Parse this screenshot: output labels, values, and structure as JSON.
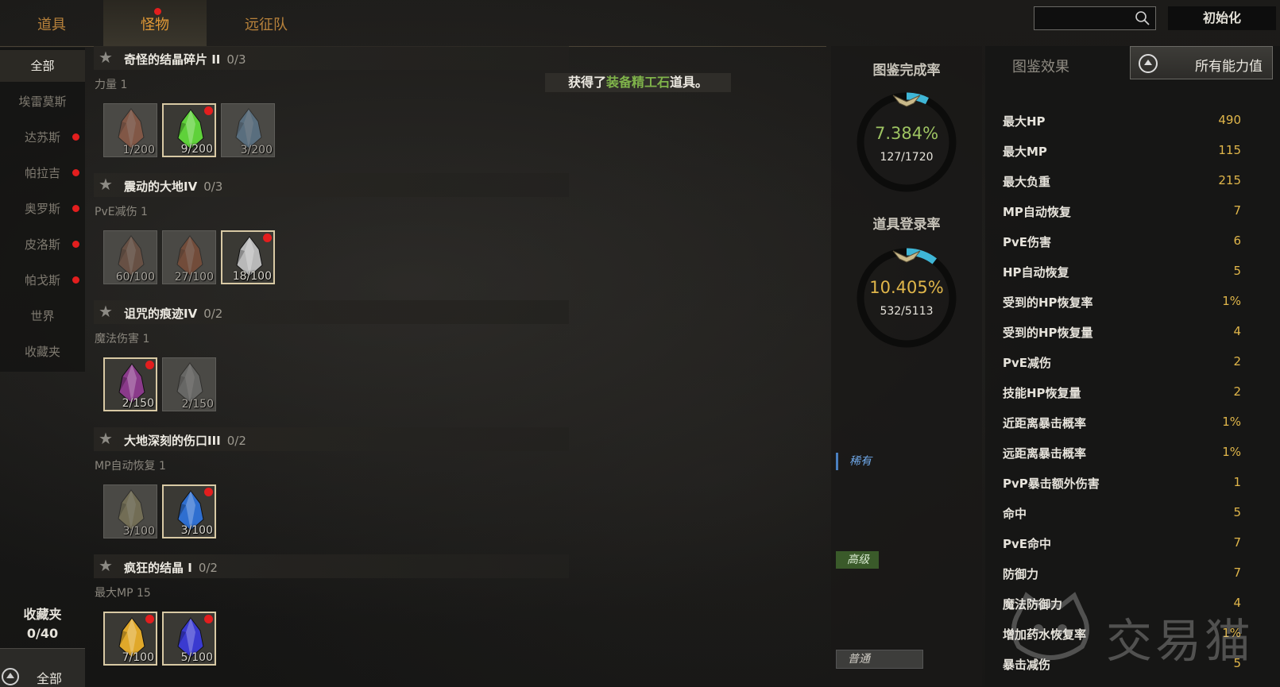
{
  "tabs": [
    {
      "label": "道具",
      "active": false,
      "badge": false
    },
    {
      "label": "怪物",
      "active": true,
      "badge": true
    },
    {
      "label": "远征队",
      "active": false,
      "badge": false
    }
  ],
  "search": {
    "value": "",
    "placeholder": ""
  },
  "init_button": "初始化",
  "sidebar": {
    "items": [
      {
        "label": "全部",
        "active": true,
        "badge": false
      },
      {
        "label": "埃雷莫斯",
        "active": false,
        "badge": false
      },
      {
        "label": "达苏斯",
        "active": false,
        "badge": true
      },
      {
        "label": "帕拉吉",
        "active": false,
        "badge": true
      },
      {
        "label": "奥罗斯",
        "active": false,
        "badge": true
      },
      {
        "label": "皮洛斯",
        "active": false,
        "badge": true
      },
      {
        "label": "帕戈斯",
        "active": false,
        "badge": true
      },
      {
        "label": "世界",
        "active": false,
        "badge": false
      },
      {
        "label": "收藏夹",
        "active": false,
        "badge": false
      }
    ],
    "favorites_title": "收藏夹",
    "favorites_count": "0/40",
    "bottom_button": "全部"
  },
  "toast": {
    "prefix": "获得了",
    "highlight": "装备精工石",
    "suffix": "道具。"
  },
  "groups": [
    {
      "title": "奇怪的结晶碎片 II",
      "progress": "0/3",
      "stat": "力量 1",
      "items": [
        {
          "count": "1/200",
          "color": "#c46a48",
          "owned": false,
          "badge": false
        },
        {
          "count": "9/200",
          "color": "#5fd13a",
          "owned": true,
          "badge": true
        },
        {
          "count": "3/200",
          "color": "#6d9cc4",
          "owned": false,
          "badge": false
        }
      ]
    },
    {
      "title": "震动的大地IV",
      "progress": "0/3",
      "stat": "PvE减伤 1",
      "items": [
        {
          "count": "60/100",
          "color": "#8a5a44",
          "owned": false,
          "badge": false
        },
        {
          "count": "27/100",
          "color": "#a3502e",
          "owned": false,
          "badge": false
        },
        {
          "count": "18/100",
          "color": "#b8b8b8",
          "owned": true,
          "badge": true
        }
      ]
    },
    {
      "title": "诅咒的痕迹IV",
      "progress": "0/2",
      "stat": "魔法伤害 1",
      "items": [
        {
          "count": "2/150",
          "color": "#8a3a8a",
          "owned": true,
          "badge": true
        },
        {
          "count": "2/150",
          "color": "#8c8c8c",
          "owned": false,
          "badge": false
        }
      ]
    },
    {
      "title": "大地深刻的伤口III",
      "progress": "0/2",
      "stat": "MP自动恢复 1",
      "items": [
        {
          "count": "3/100",
          "color": "#a39a6a",
          "owned": false,
          "badge": false
        },
        {
          "count": "3/100",
          "color": "#2f6fd0",
          "owned": true,
          "badge": true
        }
      ]
    },
    {
      "title": "疯狂的结晶 I",
      "progress": "0/2",
      "stat": "最大MP 15",
      "items": [
        {
          "count": "7/100",
          "color": "#e0a82a",
          "owned": true,
          "badge": true
        },
        {
          "count": "5/100",
          "color": "#3a3ad0",
          "owned": true,
          "badge": true
        }
      ]
    }
  ],
  "completion": {
    "title": "图鉴完成率",
    "percent_text": "7.384%",
    "fraction": "127/1720",
    "value": 0.07384,
    "color": "#9ec462"
  },
  "registration": {
    "title": "道具登录率",
    "percent_text": "10.405%",
    "fraction": "532/5113",
    "value": 0.10405,
    "color": "#e0b64a"
  },
  "grades": {
    "rare": "稀有",
    "high": "高级",
    "common": "普通"
  },
  "effects_tab": "图鉴效果",
  "all_stats_button": "所有能力值",
  "stats": [
    {
      "name": "最大HP",
      "value": "490"
    },
    {
      "name": "最大MP",
      "value": "115"
    },
    {
      "name": "最大负重",
      "value": "215"
    },
    {
      "name": "MP自动恢复",
      "value": "7"
    },
    {
      "name": "PvE伤害",
      "value": "6"
    },
    {
      "name": "HP自动恢复",
      "value": "5"
    },
    {
      "name": "受到的HP恢复率",
      "value": "1%"
    },
    {
      "name": "受到的HP恢复量",
      "value": "4"
    },
    {
      "name": "PvE减伤",
      "value": "2"
    },
    {
      "name": "技能HP恢复量",
      "value": "2"
    },
    {
      "name": "近距离暴击概率",
      "value": "1%"
    },
    {
      "name": "远距离暴击概率",
      "value": "1%"
    },
    {
      "name": "PvP暴击额外伤害",
      "value": "1"
    },
    {
      "name": "命中",
      "value": "5"
    },
    {
      "name": "PvE命中",
      "value": "7"
    },
    {
      "name": "防御力",
      "value": "7"
    },
    {
      "name": "魔法防御力",
      "value": "4"
    },
    {
      "name": "增加药水恢复率",
      "value": "1%"
    },
    {
      "name": "暴击减伤",
      "value": "5"
    }
  ],
  "watermark": "交易猫"
}
